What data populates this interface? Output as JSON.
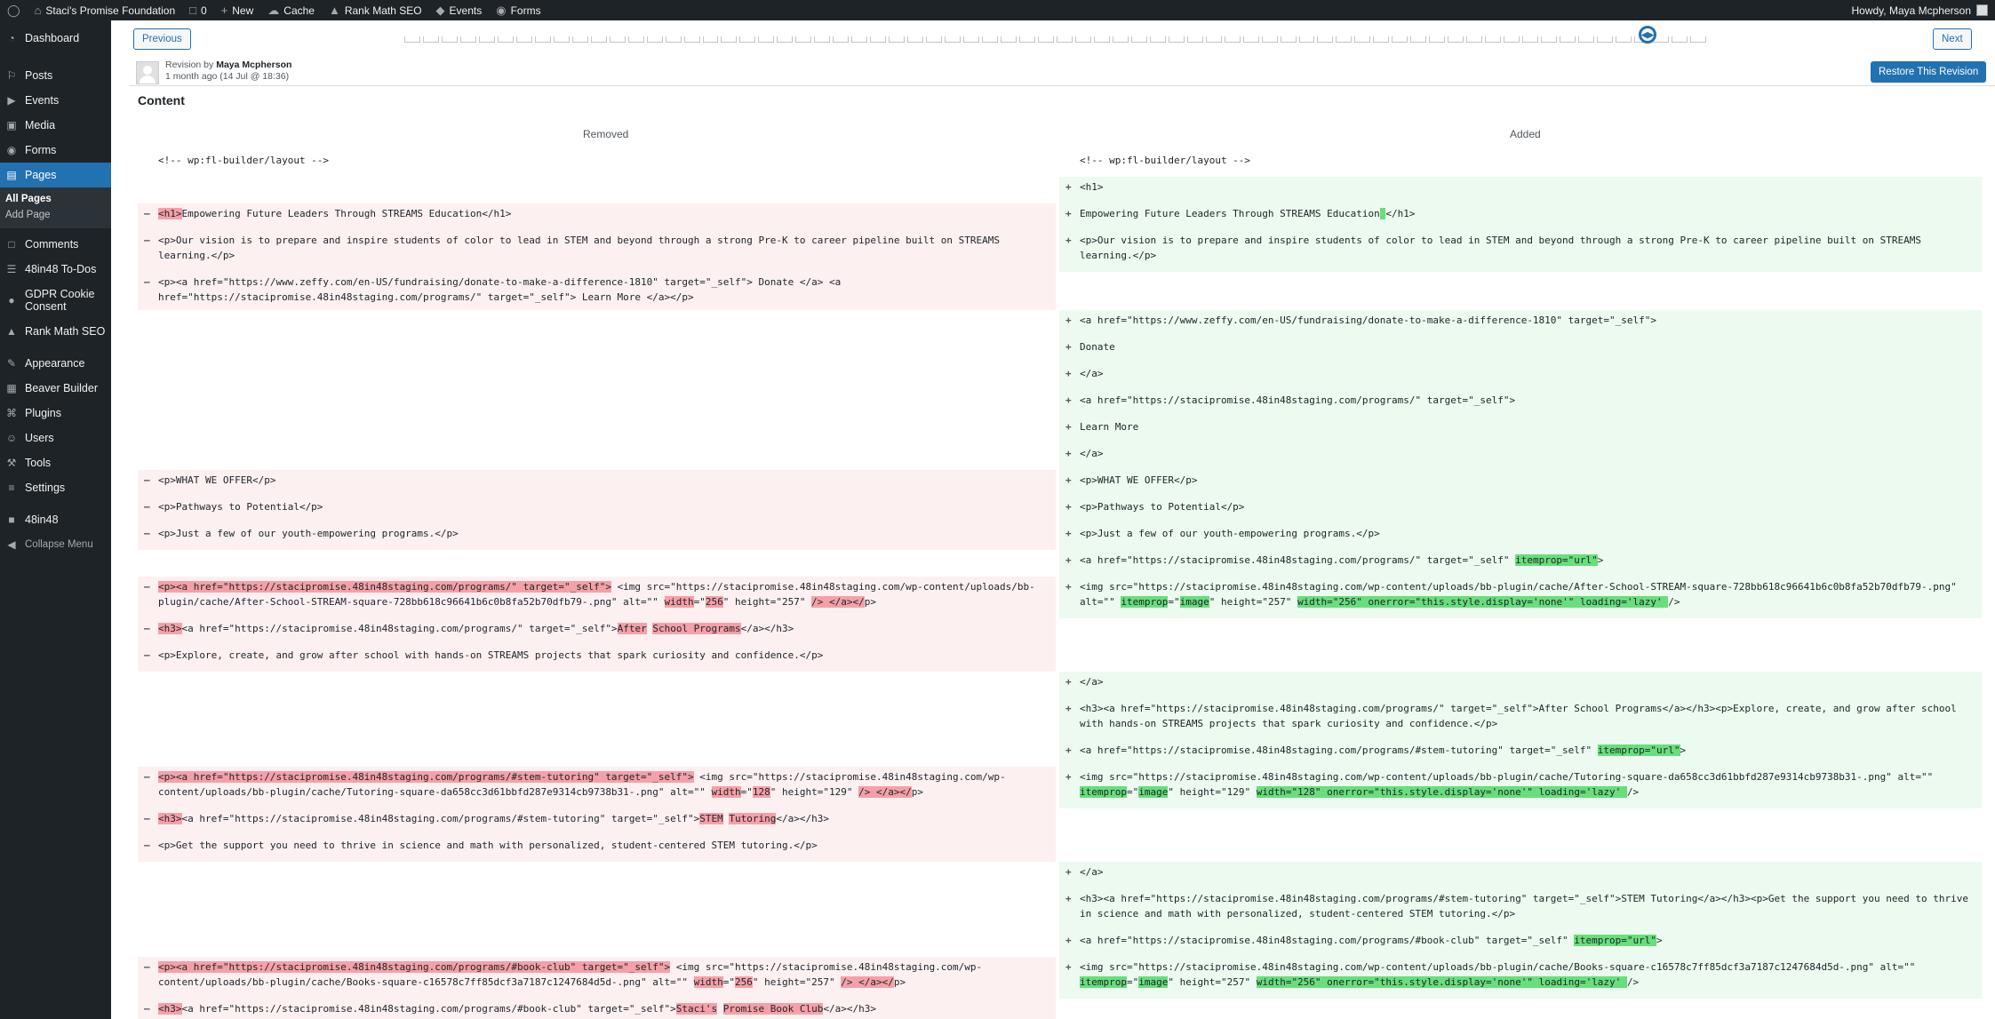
{
  "admin_bar": {
    "site_name": "Staci's Promise Foundation",
    "comments_count": "0",
    "new_label": "New",
    "cache_label": "Cache",
    "seo_label": "Rank Math SEO",
    "events_label": "Events",
    "forms_label": "Forms",
    "howdy": "Howdy, Maya Mcpherson"
  },
  "sidebar": {
    "items": [
      {
        "name": "dashboard",
        "label": "Dashboard",
        "icon": "gauge-icon"
      },
      {
        "name": "posts",
        "label": "Posts",
        "icon": "pin-icon"
      },
      {
        "name": "events",
        "label": "Events",
        "icon": "megaphone-icon"
      },
      {
        "name": "media",
        "label": "Media",
        "icon": "media-icon"
      },
      {
        "name": "forms",
        "label": "Forms",
        "icon": "forms-icon"
      },
      {
        "name": "pages",
        "label": "Pages",
        "icon": "page-icon",
        "current": true
      },
      {
        "name": "comments",
        "label": "Comments",
        "icon": "comment-icon"
      },
      {
        "name": "todos",
        "label": "48in48 To-Dos",
        "icon": "list-icon"
      },
      {
        "name": "gdpr",
        "label": "GDPR Cookie Consent",
        "icon": "cookie-icon"
      },
      {
        "name": "rank-math",
        "label": "Rank Math SEO",
        "icon": "chart-icon"
      },
      {
        "name": "appearance",
        "label": "Appearance",
        "icon": "brush-icon"
      },
      {
        "name": "beaver-builder",
        "label": "Beaver Builder",
        "icon": "layout-icon"
      },
      {
        "name": "plugins",
        "label": "Plugins",
        "icon": "plug-icon"
      },
      {
        "name": "users",
        "label": "Users",
        "icon": "user-icon"
      },
      {
        "name": "tools",
        "label": "Tools",
        "icon": "wrench-icon"
      },
      {
        "name": "settings",
        "label": "Settings",
        "icon": "sliders-icon"
      },
      {
        "name": "48in48",
        "label": "48in48",
        "icon": "48-icon"
      }
    ],
    "submenu": [
      "All Pages",
      "Add Page"
    ],
    "collapse": "Collapse Menu"
  },
  "revision": {
    "previous": "Previous",
    "next": "Next",
    "by_prefix": "Revision by",
    "author": "Maya Mcpherson",
    "time": "1 month ago (14 Jul @ 18:36)",
    "restore": "Restore This Revision",
    "heading": "Content",
    "removed": "Removed",
    "added": "Added",
    "slider_position": 0.955
  },
  "diff_rows": [
    {
      "h": 30,
      "left": {
        "t": "c",
        "p": [
          [
            "<!-- wp:fl-builder/layout -->",
            ""
          ]
        ]
      },
      "right": {
        "t": "c",
        "p": [
          [
            "<!-- wp:fl-builder/layout -->",
            ""
          ]
        ]
      }
    },
    {
      "h": 30,
      "left": null,
      "right": {
        "t": "i",
        "p": [
          [
            "<h1>",
            ""
          ]
        ]
      }
    },
    {
      "h": 30,
      "left": {
        "t": "d",
        "p": [
          [
            "<h1>",
            "d"
          ],
          [
            "Empowering Future Leaders Through STREAMS Education</h1>",
            ""
          ]
        ]
      },
      "right": {
        "t": "i",
        "p": [
          [
            " ",
            "i"
          ],
          [
            "Empowering Future Leaders Through STREAMS Education",
            ""
          ],
          [
            " ",
            "i"
          ],
          [
            "</h1>",
            ""
          ]
        ]
      }
    },
    {
      "h": 47,
      "left": {
        "t": "d",
        "p": [
          [
            "<p>Our vision is to prepare and inspire students of color to lead in STEM and beyond through a strong Pre-K to career pipeline built on STREAMS learning.</p>",
            ""
          ]
        ]
      },
      "right": {
        "t": "i",
        "p": [
          [
            " ",
            "i"
          ],
          [
            "<p>Our vision is to prepare and inspire students of color to lead in STEM and beyond through a strong Pre-K to career pipeline built on STREAMS learning.</p>",
            ""
          ]
        ]
      }
    },
    {
      "h": 43,
      "left": {
        "t": "d",
        "p": [
          [
            "<p><a href=\"https://www.zeffy.com/en-US/fundraising/donate-to-make-a-difference-1810\" target=\"_self\"> Donate </a> <a href=\"https://stacipromise.48in48staging.com/programs/\" target=\"_self\"> Learn More </a></p>",
            ""
          ]
        ]
      },
      "right": null
    },
    {
      "h": 30,
      "left": null,
      "right": {
        "t": "i",
        "p": [
          [
            " <a href=\"https://www.zeffy.com/en-US/fundraising/donate-to-make-a-difference-1810\" target=\"_self\">",
            ""
          ]
        ]
      }
    },
    {
      "h": 30,
      "left": null,
      "right": {
        "t": "i",
        "p": [
          [
            " Donate",
            ""
          ]
        ]
      }
    },
    {
      "h": 30,
      "left": null,
      "right": {
        "t": "i",
        "p": [
          [
            " </a>",
            ""
          ]
        ]
      }
    },
    {
      "h": 30,
      "left": null,
      "right": {
        "t": "i",
        "p": [
          [
            " <a href=\"https://stacipromise.48in48staging.com/programs/\" target=\"_self\">",
            ""
          ]
        ]
      }
    },
    {
      "h": 30,
      "left": null,
      "right": {
        "t": "i",
        "p": [
          [
            " Learn More",
            ""
          ]
        ]
      }
    },
    {
      "h": 30,
      "left": null,
      "right": {
        "t": "i",
        "p": [
          [
            " </a>",
            ""
          ]
        ]
      }
    },
    {
      "h": 30,
      "left": {
        "t": "d",
        "p": [
          [
            "<p>WHAT WE OFFER</p>",
            ""
          ]
        ]
      },
      "right": {
        "t": "i",
        "p": [
          [
            " ",
            "i"
          ],
          [
            "<p>WHAT WE OFFER</p>",
            ""
          ]
        ]
      }
    },
    {
      "h": 30,
      "left": {
        "t": "d",
        "p": [
          [
            "<p>Pathways to Potential</p>",
            ""
          ]
        ]
      },
      "right": {
        "t": "i",
        "p": [
          [
            " ",
            "i"
          ],
          [
            "<p>Pathways to Potential</p>",
            ""
          ]
        ]
      }
    },
    {
      "h": 30,
      "left": {
        "t": "d",
        "p": [
          [
            "<p>Just a few of our youth-empowering programs.</p>",
            ""
          ]
        ]
      },
      "right": {
        "t": "i",
        "p": [
          [
            " ",
            "i"
          ],
          [
            "<p>Just a few of our youth-empowering programs.</p>",
            ""
          ]
        ]
      }
    },
    {
      "h": 30,
      "left": null,
      "right": {
        "t": "i",
        "p": [
          [
            " ",
            "i"
          ],
          [
            "<a href=\"https://stacipromise.48in48staging.com/programs/\" target=\"_self\" ",
            ""
          ],
          [
            "itemprop=\"url\"",
            "i"
          ],
          [
            ">",
            ""
          ]
        ]
      }
    },
    {
      "h": 47,
      "left": {
        "t": "d",
        "p": [
          [
            "<p><a href=\"https://stacipromise.48in48staging.com/programs/\" target=\"_self\">",
            "d"
          ],
          [
            " <img src=\"https://stacipromise.48in48staging.com/wp-content/uploads/bb-plugin/cache/After-School-STREAM-square-728bb618c96641b6c0b8fa52b70dfb79-.png\" alt=\"\" ",
            ""
          ],
          [
            "width",
            "d"
          ],
          [
            "=\"",
            ""
          ],
          [
            "256",
            "d"
          ],
          [
            "\" height=\"257\" ",
            ""
          ],
          [
            "/> </a></",
            "d"
          ],
          [
            "p>",
            ""
          ]
        ]
      },
      "right": {
        "t": "i",
        "p": [
          [
            " <img src=\"https://stacipromise.48in48staging.com/wp-content/uploads/bb-plugin/cache/After-School-STREAM-square-728bb618c96641b6c0b8fa52b70dfb79-.png\" alt=\"\" ",
            ""
          ],
          [
            "itemprop",
            "i"
          ],
          [
            "=\"",
            ""
          ],
          [
            "image",
            "i"
          ],
          [
            "\" height=\"257\" ",
            ""
          ],
          [
            "width=\"256\" onerror=\"this.style.display='none'\" loading='lazy' ",
            "i"
          ],
          [
            "/>",
            ""
          ]
        ]
      }
    },
    {
      "h": 30,
      "left": {
        "t": "d",
        "p": [
          [
            "<h3>",
            "d"
          ],
          [
            "<a href=\"https://stacipromise.48in48staging.com/programs/\" target=\"_self\">",
            ""
          ],
          [
            "After",
            "d"
          ],
          [
            " ",
            ""
          ],
          [
            "School Programs",
            "d"
          ],
          [
            "</a></h3>",
            ""
          ]
        ]
      },
      "right": null
    },
    {
      "h": 30,
      "left": {
        "t": "d",
        "p": [
          [
            "<p>Explore, create, and grow after school with hands-on STREAMS projects that spark curiosity and confidence.</p>",
            ""
          ]
        ]
      },
      "right": null
    },
    {
      "h": 30,
      "left": null,
      "right": {
        "t": "i",
        "p": [
          [
            " </a>",
            ""
          ]
        ]
      }
    },
    {
      "h": 47,
      "left": null,
      "right": {
        "t": "i",
        "p": [
          [
            "<h3><a href=\"https://stacipromise.48in48staging.com/programs/\" target=\"_self\">After School Programs</a></h3><p>Explore, create, and grow after school with hands-on STREAMS projects that spark curiosity and confidence.</p>",
            ""
          ]
        ]
      }
    },
    {
      "h": 30,
      "left": null,
      "right": {
        "t": "i",
        "p": [
          [
            " ",
            "i"
          ],
          [
            "<a href=\"https://stacipromise.48in48staging.com/programs/#stem-tutoring\" target=\"_self\" ",
            ""
          ],
          [
            "itemprop=\"url\"",
            "i"
          ],
          [
            ">",
            ""
          ]
        ]
      }
    },
    {
      "h": 47,
      "left": {
        "t": "d",
        "p": [
          [
            "<p><a href=\"https://stacipromise.48in48staging.com/programs/#stem-tutoring\" target=\"_self\">",
            "d"
          ],
          [
            " <img src=\"https://stacipromise.48in48staging.com/wp-content/uploads/bb-plugin/cache/Tutoring-square-da658cc3d61bbfd287e9314cb9738b31-.png\" alt=\"\" ",
            ""
          ],
          [
            "width",
            "d"
          ],
          [
            "=\"",
            ""
          ],
          [
            "128",
            "d"
          ],
          [
            "\" height=\"129\" ",
            ""
          ],
          [
            "/> </a></",
            "d"
          ],
          [
            "p>",
            ""
          ]
        ]
      },
      "right": {
        "t": "i",
        "p": [
          [
            " <img src=\"https://stacipromise.48in48staging.com/wp-content/uploads/bb-plugin/cache/Tutoring-square-da658cc3d61bbfd287e9314cb9738b31-.png\" alt=\"\" ",
            ""
          ],
          [
            "itemprop",
            "i"
          ],
          [
            "=\"",
            ""
          ],
          [
            "image",
            "i"
          ],
          [
            "\" height=\"129\" ",
            ""
          ],
          [
            "width=\"128\" onerror=\"this.style.display='none'\" loading='lazy' ",
            "i"
          ],
          [
            "/>",
            ""
          ]
        ]
      }
    },
    {
      "h": 30,
      "left": {
        "t": "d",
        "p": [
          [
            "<h3>",
            "d"
          ],
          [
            "<a href=\"https://stacipromise.48in48staging.com/programs/#stem-tutoring\" target=\"_self\">",
            ""
          ],
          [
            "STEM",
            "d"
          ],
          [
            " ",
            ""
          ],
          [
            "Tutoring",
            "d"
          ],
          [
            "</a></h3>",
            ""
          ]
        ]
      },
      "right": null
    },
    {
      "h": 30,
      "left": {
        "t": "d",
        "p": [
          [
            "<p>Get the support you need to thrive in science and math with personalized, student-centered STEM tutoring.</p>",
            ""
          ]
        ]
      },
      "right": null
    },
    {
      "h": 30,
      "left": null,
      "right": {
        "t": "i",
        "p": [
          [
            " </a>",
            ""
          ]
        ]
      }
    },
    {
      "h": 47,
      "left": null,
      "right": {
        "t": "i",
        "p": [
          [
            "<h3><a href=\"https://stacipromise.48in48staging.com/programs/#stem-tutoring\" target=\"_self\">STEM Tutoring</a></h3><p>Get the support you need to thrive in science and math with personalized, student-centered STEM tutoring.</p>",
            ""
          ]
        ]
      }
    },
    {
      "h": 30,
      "left": null,
      "right": {
        "t": "i",
        "p": [
          [
            " ",
            "i"
          ],
          [
            "<a href=\"https://stacipromise.48in48staging.com/programs/#book-club\" target=\"_self\" ",
            ""
          ],
          [
            "itemprop=\"url\"",
            "i"
          ],
          [
            ">",
            ""
          ]
        ]
      }
    },
    {
      "h": 47,
      "left": {
        "t": "d",
        "p": [
          [
            "<p><a href=\"https://stacipromise.48in48staging.com/programs/#book-club\" target=\"_self\">",
            "d"
          ],
          [
            " <img src=\"https://stacipromise.48in48staging.com/wp-content/uploads/bb-plugin/cache/Books-square-c16578c7ff85dcf3a7187c1247684d5d-.png\" alt=\"\" ",
            ""
          ],
          [
            "width",
            "d"
          ],
          [
            "=\"",
            ""
          ],
          [
            "256",
            "d"
          ],
          [
            "\" height=\"257\" ",
            ""
          ],
          [
            "/> </a></",
            "d"
          ],
          [
            "p>",
            ""
          ]
        ]
      },
      "right": {
        "t": "i",
        "p": [
          [
            " <img src=\"https://stacipromise.48in48staging.com/wp-content/uploads/bb-plugin/cache/Books-square-c16578c7ff85dcf3a7187c1247684d5d-.png\" alt=\"\" ",
            ""
          ],
          [
            "itemprop",
            "i"
          ],
          [
            "=\"",
            ""
          ],
          [
            "image",
            "i"
          ],
          [
            "\" height=\"257\" ",
            ""
          ],
          [
            "width=\"256\" onerror=\"this.style.display='none'\" loading='lazy' ",
            "i"
          ],
          [
            "/>",
            ""
          ]
        ]
      }
    },
    {
      "h": 30,
      "left": {
        "t": "d",
        "p": [
          [
            "<h3>",
            "d"
          ],
          [
            "<a href=\"https://stacipromise.48in48staging.com/programs/#book-club\" target=\"_self\">",
            ""
          ],
          [
            "Staci's",
            "d"
          ],
          [
            " ",
            ""
          ],
          [
            "Promise Book Club",
            "d"
          ],
          [
            "</a></h3>",
            ""
          ]
        ]
      },
      "right": null
    }
  ]
}
